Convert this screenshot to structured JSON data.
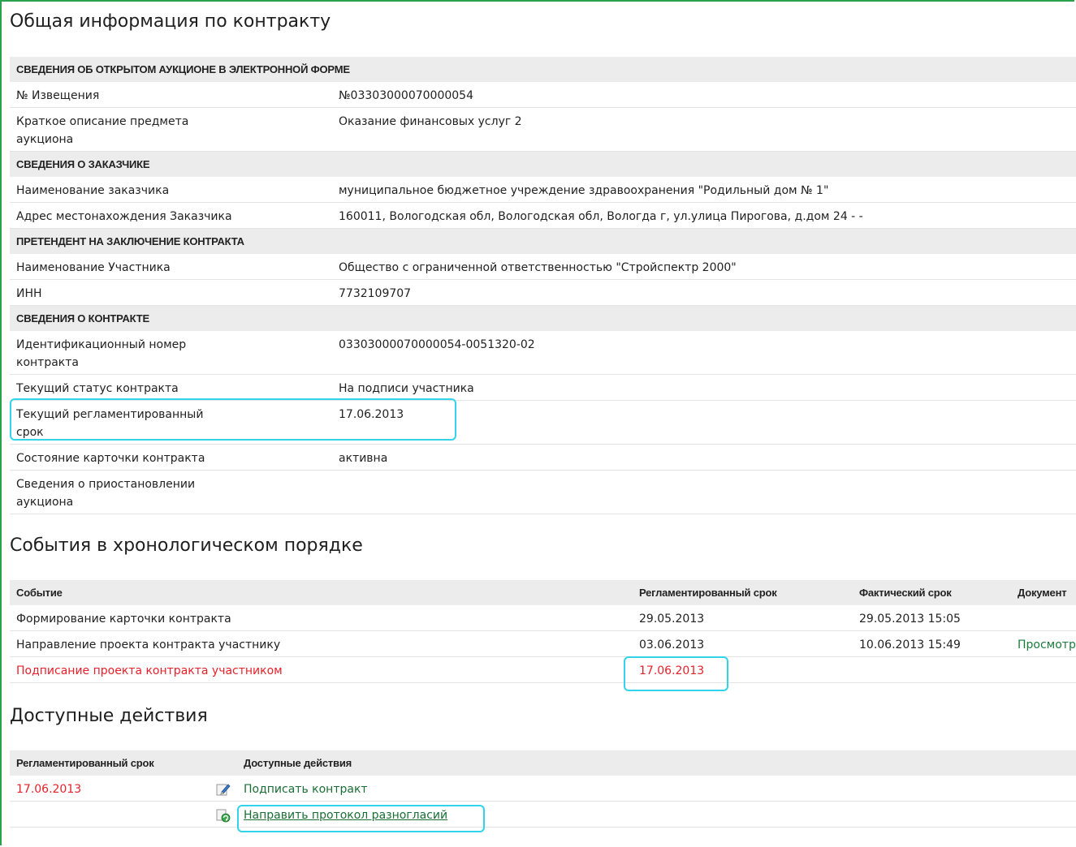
{
  "main": {
    "title": "Общая информация по контракту",
    "sections": [
      {
        "header": "СВЕДЕНИЯ ОБ ОТКРЫТОМ АУКЦИОНЕ В ЭЛЕКТРОННОЙ ФОРМЕ",
        "rows": [
          {
            "label": "№ Извещения",
            "value": "№03303000070000054"
          },
          {
            "label": "Краткое описание предмета аукциона",
            "value": "Оказание финансовых услуг 2"
          }
        ]
      },
      {
        "header": "СВЕДЕНИЯ О ЗАКАЗЧИКЕ",
        "rows": [
          {
            "label": "Наименование заказчика",
            "value": "муниципальное бюджетное учреждение здравоохранения \"Родильный дом № 1\""
          },
          {
            "label": "Адрес местонахождения Заказчика",
            "value": "160011, Вологодская обл, Вологодская обл, Вологда г, ул.улица Пирогова, д.дом 24 - -"
          }
        ]
      },
      {
        "header": "ПРЕТЕНДЕНТ НА ЗАКЛЮЧЕНИЕ КОНТРАКТА",
        "rows": [
          {
            "label": "Наименование Участника",
            "value": "Общество с ограниченной ответственностью \"Стройспектр 2000\""
          },
          {
            "label": "ИНН",
            "value": "7732109707"
          }
        ]
      },
      {
        "header": "СВЕДЕНИЯ О КОНТРАКТЕ",
        "rows": [
          {
            "label": "Идентификационный номер контракта",
            "value": "03303000070000054-0051320-02"
          },
          {
            "label": "Текущий статус контракта",
            "value": "На подписи участника"
          },
          {
            "label": "Текущий регламентированный срок",
            "value": "17.06.2013"
          },
          {
            "label": "Состояние карточки контракта",
            "value": "активна"
          },
          {
            "label": "Сведения о приостановлении аукциона",
            "value": ""
          }
        ]
      }
    ]
  },
  "events": {
    "title": "События в хронологическом порядке",
    "headers": {
      "event": "Событие",
      "deadline": "Регламентированный срок",
      "actual": "Фактический срок",
      "document": "Документ"
    },
    "rows": [
      {
        "event": "Формирование карточки контракта",
        "deadline": "29.05.2013",
        "actual": "29.05.2013 15:05",
        "document": ""
      },
      {
        "event": "Направление проекта контракта участнику",
        "deadline": "03.06.2013",
        "actual": "10.06.2013 15:49",
        "document": "Просмотр"
      },
      {
        "event": "Подписание проекта контракта участником",
        "deadline": "17.06.2013",
        "actual": "",
        "document": ""
      }
    ]
  },
  "actions": {
    "title": "Доступные действия",
    "headers": {
      "deadline": "Регламентированный срок",
      "actions": "Доступные действия"
    },
    "rows": [
      {
        "deadline": "17.06.2013",
        "icon": "pencil-edit-icon",
        "label": "Подписать контракт"
      },
      {
        "deadline": "",
        "icon": "refresh-send-icon",
        "label": "Направить протокол разногласий"
      }
    ]
  },
  "colors": {
    "frame": "#2aa14b",
    "header_bg": "#ececec",
    "alert_red": "#e8202a",
    "link_green": "#1a6e34",
    "highlight": "#32d4ec"
  }
}
